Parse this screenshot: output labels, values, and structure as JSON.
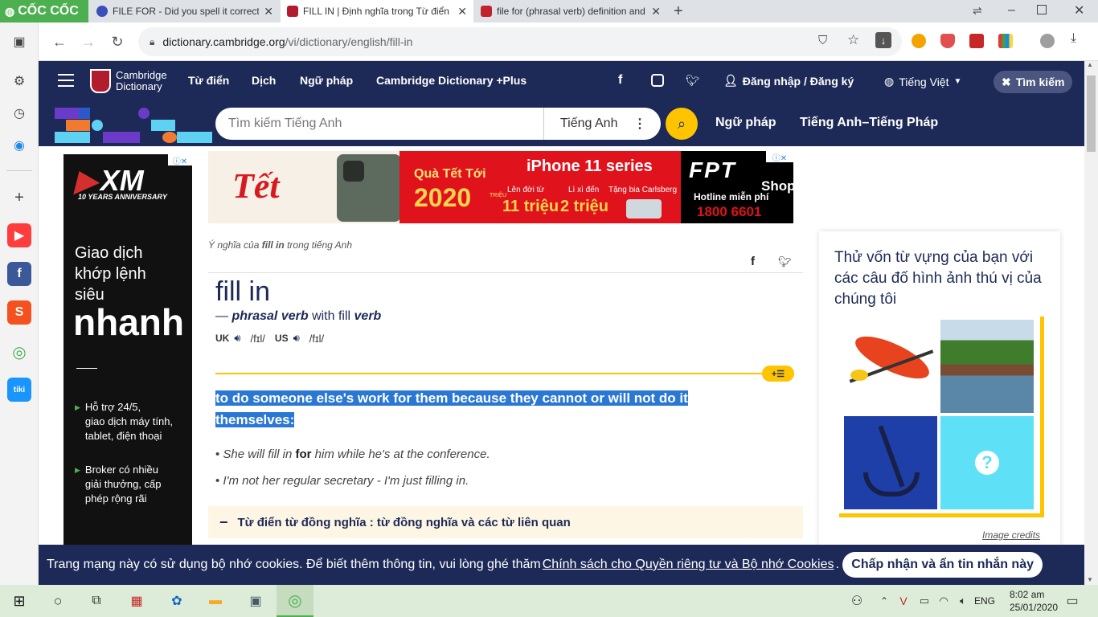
{
  "browser": {
    "brand": "CỐC CỐC",
    "tabs": [
      {
        "title": "FILE FOR - Did you spell it correctly",
        "active": false,
        "color": "#3b4fb8"
      },
      {
        "title": "FILL IN | Định nghĩa trong Từ điển",
        "active": true,
        "color": "#b21d2e"
      },
      {
        "title": "file for (phrasal verb) definition and",
        "active": false,
        "color": "#c0232c"
      }
    ],
    "url_host": "dictionary.cambridge.org",
    "url_path": "/vi/dictionary/english/fill-in"
  },
  "nav": {
    "logo_line1": "Cambridge",
    "logo_line2": "Dictionary",
    "items": [
      "Từ điển",
      "Dịch",
      "Ngữ pháp",
      "Cambridge Dictionary +Plus"
    ],
    "login": "Đăng nhập / Đăng ký",
    "language": "Tiếng Việt",
    "search_toggle": "Tìm kiếm"
  },
  "search": {
    "placeholder": "Tìm kiếm Tiếng Anh",
    "language": "Tiếng Anh",
    "links": [
      "Ngữ pháp",
      "Tiếng Anh–Tiếng Pháp"
    ]
  },
  "left_ad": {
    "brand": "XM",
    "anniversary": "10 YEARS ANNIVERSARY",
    "headline1": "Giao dịch",
    "headline2": "khớp lệnh",
    "headline3": "siêu",
    "headline_big": "nhanh",
    "bullet1a": "Hỗ trợ 24/5,",
    "bullet1b": "giao dịch máy tính,",
    "bullet1c": "tablet, điện thoại",
    "bullet2a": "Broker có nhiều",
    "bullet2b": "giải thưởng, cấp",
    "bullet2c": "phép rộng rãi"
  },
  "top_ad": {
    "tet": "Tết",
    "qua": "Quà Tết Tới",
    "year": "2020",
    "trieu_small": "TRIỆU",
    "phone": "iPhone 11 series",
    "len_doi": "Lên đời từ",
    "li_xi": "Lì xì đến",
    "tang_bia": "Tặng bia Carlsberg",
    "amount1": "11 triệu",
    "amount2": "2 triệu",
    "fpt": "FPT",
    "shop": "Shop",
    "hotline": "Hotline miễn phí",
    "phone_no": "1800 6601"
  },
  "entry": {
    "breadcrumb_pre": "Ý nghĩa của",
    "breadcrumb_word": "fill in",
    "breadcrumb_post": "trong tiếng Anh",
    "headword": "fill in",
    "pos_dash": "—",
    "pos": "phrasal verb",
    "with_text": "with fill",
    "verb": "verb",
    "uk_label": "UK",
    "uk_ipa": "/fɪl/",
    "us_label": "US",
    "us_ipa": "/fɪl/",
    "definition": "to do someone else's work for them because they cannot or will not do it themselves:",
    "example1_pre": "She will fill in",
    "example1_bold": "for",
    "example1_post": "him while he's at the conference.",
    "example2": "I'm not her regular secretary - I'm just filling in.",
    "thesaurus": "Từ điển từ đồng nghĩa : từ đồng nghĩa và các từ liên quan"
  },
  "quiz": {
    "title": "Thử vốn từ vựng của bạn với các câu đố hình ảnh thú vị của chúng tôi",
    "credits": "Image credits"
  },
  "cookie": {
    "text": "Trang mạng này có sử dụng bộ nhớ cookies. Để biết thêm thông tin, vui lòng ghé thăm",
    "link": "Chính sách cho Quyền riêng tư và Bộ nhớ Cookies",
    "period": ".",
    "accept": "Chấp nhận và ẩn tin nhắn này"
  },
  "taskbar": {
    "time": "8:02 am",
    "date": "25/01/2020",
    "lang": "ENG"
  },
  "colors": {
    "brand_navy": "#1d2a57",
    "accent_yellow": "#fec400",
    "highlight_blue": "#2a78d4"
  }
}
